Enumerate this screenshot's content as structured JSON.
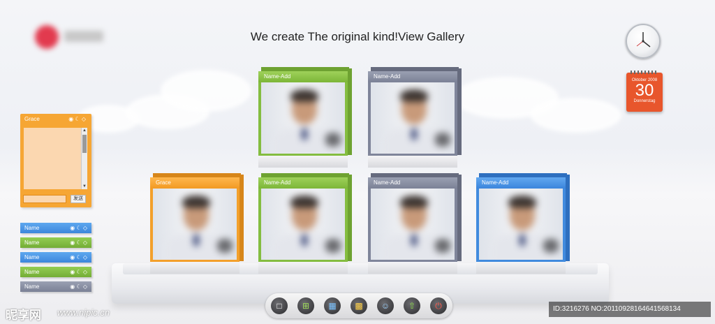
{
  "page": {
    "title": "We create The original kind!View Gallery"
  },
  "calendar": {
    "month": "Oktober 2008",
    "day": "30",
    "weekday": "Donnerstag"
  },
  "chat": {
    "name": "Grace",
    "send_label": "发送"
  },
  "contacts": [
    {
      "name": "Name",
      "theme": "blue"
    },
    {
      "name": "Name",
      "theme": "green"
    },
    {
      "name": "Name",
      "theme": "blue"
    },
    {
      "name": "Name",
      "theme": "green"
    },
    {
      "name": "Name",
      "theme": "gray"
    }
  ],
  "gallery": [
    {
      "label": "Name-Add",
      "theme": "green"
    },
    {
      "label": "Name-Add",
      "theme": "gray"
    },
    {
      "label": "Grace",
      "theme": "orange"
    },
    {
      "label": "Name-Add",
      "theme": "green"
    },
    {
      "label": "Name-Add",
      "theme": "gray"
    },
    {
      "label": "Name-Add",
      "theme": "blue"
    }
  ],
  "toolbar": [
    "single-view-icon",
    "grid-4-icon",
    "grid-9-icon",
    "grid-16-icon",
    "user-icon",
    "upload-icon",
    "power-icon"
  ],
  "watermark": {
    "logo": "昵享网",
    "url": "www.nipic.cn",
    "id": "ID:3216276 NO:20110928164641568134"
  },
  "colors": {
    "green": "#84bd40",
    "gray": "#7f859a",
    "orange": "#f3a02b",
    "blue": "#418bde"
  }
}
